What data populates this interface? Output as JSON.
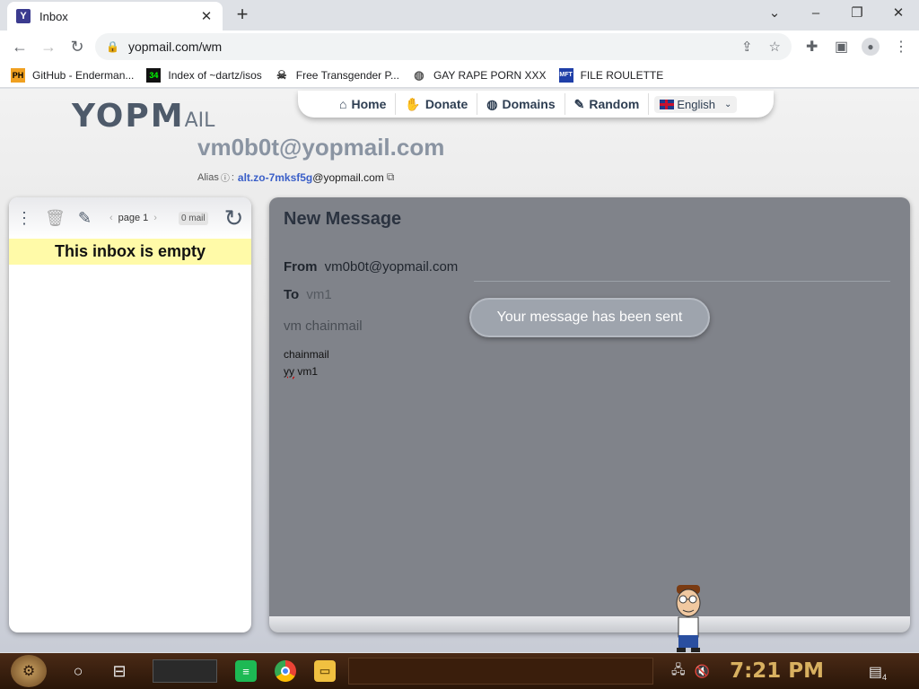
{
  "browser": {
    "tab_title": "Inbox",
    "tab_favicon": "Y",
    "new_tab_glyph": "+",
    "close_glyph": "✕",
    "window_controls": [
      "⌄",
      "–",
      "❐",
      "✕"
    ],
    "url": "yopmail.com/wm",
    "bookmarks": [
      {
        "label": "GitHub - Enderman...",
        "icon": "PH"
      },
      {
        "label": "Index of ~dartz/isos",
        "icon": "34"
      },
      {
        "label": "Free Transgender P...",
        "icon": "skull"
      },
      {
        "label": "GAY RAPE PORN XXX",
        "icon": "globe"
      },
      {
        "label": "FILE ROULETTE",
        "icon": "MFT"
      }
    ]
  },
  "site": {
    "logo": "YOPM",
    "logo_suffix": "AIL",
    "nav": [
      {
        "label": "Home",
        "icon": "home-icon",
        "glyph": "⌂"
      },
      {
        "label": "Donate",
        "icon": "thumbs-up-icon",
        "glyph": "👍"
      },
      {
        "label": "Domains",
        "icon": "globe-icon",
        "glyph": "🌐"
      },
      {
        "label": "Random",
        "icon": "magic-wand-icon",
        "glyph": "✎"
      }
    ],
    "language": "English",
    "email": "vm0b0t@yopmail.com",
    "alias_label": "Alias",
    "alias_sep": ":",
    "alias_value": "alt.zo-7mksf5g",
    "alias_domain": "@yopmail.com"
  },
  "inbox": {
    "page_label": "page 1",
    "mail_count": "0 mail",
    "empty_text": "This inbox is empty"
  },
  "message": {
    "heading": "New Message",
    "from_label": "From",
    "from_value": "vm0b0t@yopmail.com",
    "to_label": "To",
    "to_value": "vm1",
    "subject": "vm chainmail",
    "body_line1": "chainmail",
    "body_line2_word1": "yy",
    "body_line2_word2": "vm1",
    "toast": "Your message has been sent"
  },
  "taskbar": {
    "clock": "7:21 PM",
    "notification_count": "4"
  },
  "colors": {
    "accent": "#2e3e52",
    "alias_link": "#3a5fc8",
    "empty_bar": "#fffaa8",
    "overlay_panel": "#80838a",
    "clock": "#d8b060"
  }
}
